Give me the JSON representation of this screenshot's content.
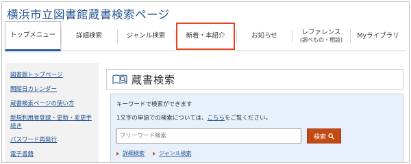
{
  "header": {
    "site_title": "横浜市立図書館蔵書検索ページ"
  },
  "nav": {
    "items": [
      {
        "label": "トップメニュー"
      },
      {
        "label": "詳細検索"
      },
      {
        "label": "ジャンル検索"
      },
      {
        "label": "新着・本紹介"
      },
      {
        "label": "お知らせ"
      },
      {
        "label": "レファレンス",
        "sub": "(調べもの・相談)"
      },
      {
        "label": "Myライブラリ"
      }
    ],
    "highlight_color": "#e8441b",
    "active_underline_color": "#2d5fa6"
  },
  "sidebar": {
    "links": [
      "図書館トップページ",
      "開館日カレンダー",
      "蔵書検索ページの使い方",
      "新規利用者登録・更新・変更手続き",
      "パスワード再発行",
      "電子書籍"
    ]
  },
  "panel": {
    "title": "蔵書検索",
    "icon": "book-search-icon"
  },
  "search": {
    "line1": "キーワードで検索ができます",
    "line2_prefix": "1文字の単語での検索については、",
    "line2_link": "こちら",
    "line2_suffix": "をご覧ください。",
    "placeholder": "フリーワード検索",
    "button_label": "検索",
    "button_color": "#c44a14",
    "sub_links": [
      "詳細検索",
      "ジャンル検索"
    ]
  }
}
